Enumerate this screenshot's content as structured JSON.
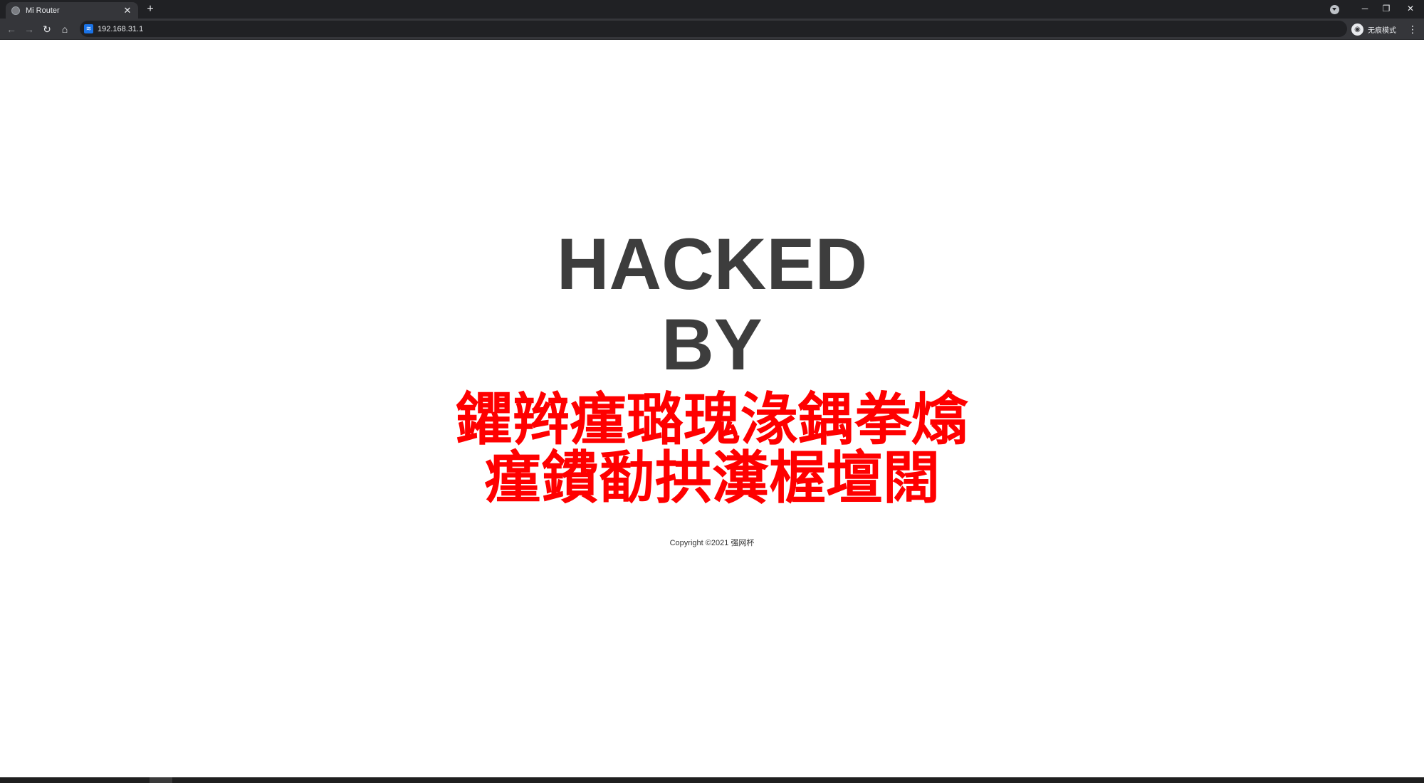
{
  "browser": {
    "tab": {
      "title": "Mi Router",
      "close": "✕"
    },
    "new_tab": "+",
    "window_controls": {
      "minimize": "─",
      "restore": "❐",
      "close": "✕"
    },
    "nav": {
      "back": "←",
      "forward": "→",
      "reload": "↻",
      "home": "⌂"
    },
    "address": {
      "url": "192.168.31.1",
      "site_icon": "wifi-icon"
    },
    "profile": {
      "label": "无痕模式",
      "avatar_icon": "incognito-icon"
    },
    "menu": "⋮"
  },
  "page": {
    "heading_line1": "HACKED",
    "heading_line2": "BY",
    "garbled_line1": "鑺辫瘽璐瑰湪鍝拳熻",
    "garbled_line2": "瘽鐨勫拱瀵楃壇闊",
    "copyright": "Copyright ©2021 强网杯"
  },
  "colors": {
    "heading": "#3d3d3d",
    "garbled": "#ff0000",
    "chrome_dark": "#202124",
    "toolbar": "#35363a"
  }
}
